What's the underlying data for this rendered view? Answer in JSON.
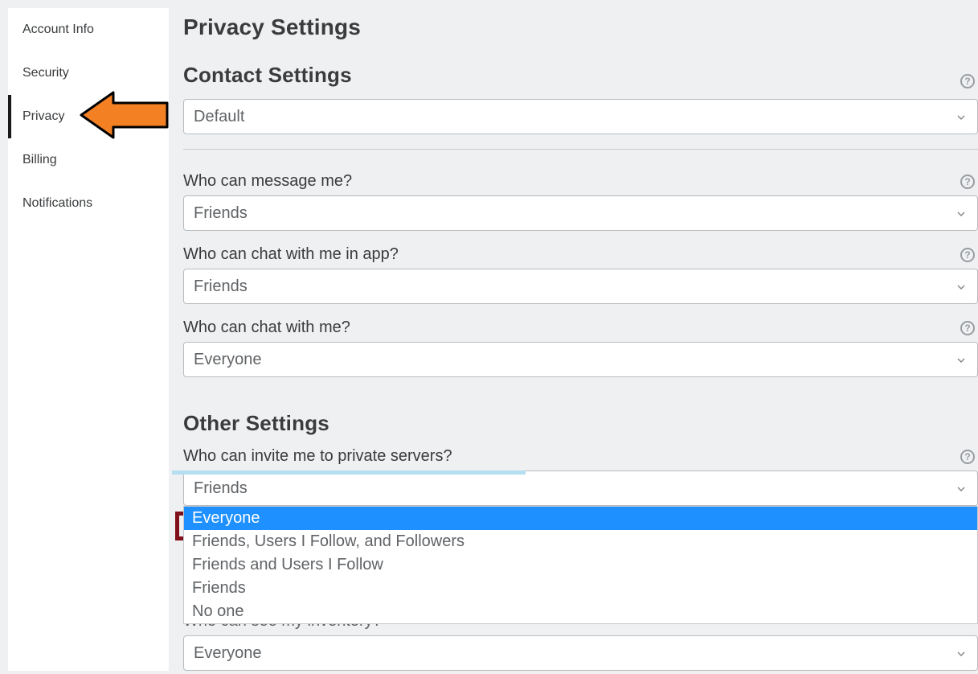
{
  "sidebar": {
    "items": [
      {
        "label": "Account Info",
        "active": false
      },
      {
        "label": "Security",
        "active": false
      },
      {
        "label": "Privacy",
        "active": true
      },
      {
        "label": "Billing",
        "active": false
      },
      {
        "label": "Notifications",
        "active": false
      }
    ]
  },
  "page": {
    "title": "Privacy Settings"
  },
  "contact_settings": {
    "title": "Contact Settings",
    "default_value": "Default",
    "fields": [
      {
        "label": "Who can message me?",
        "value": "Friends"
      },
      {
        "label": "Who can chat with me in app?",
        "value": "Friends"
      },
      {
        "label": "Who can chat with me?",
        "value": "Everyone"
      }
    ]
  },
  "other_settings": {
    "title": "Other Settings",
    "invite_field": {
      "label": "Who can invite me to private servers?",
      "value": "Friends",
      "options": [
        "Everyone",
        "Friends, Users I Follow, and Followers",
        "Friends and Users I Follow",
        "Friends",
        "No one"
      ],
      "highlighted_option_index": 0
    },
    "inventory_field": {
      "label_obscured": "Who can see my inventory?",
      "value": "Everyone"
    }
  },
  "help_icon_text": "?"
}
